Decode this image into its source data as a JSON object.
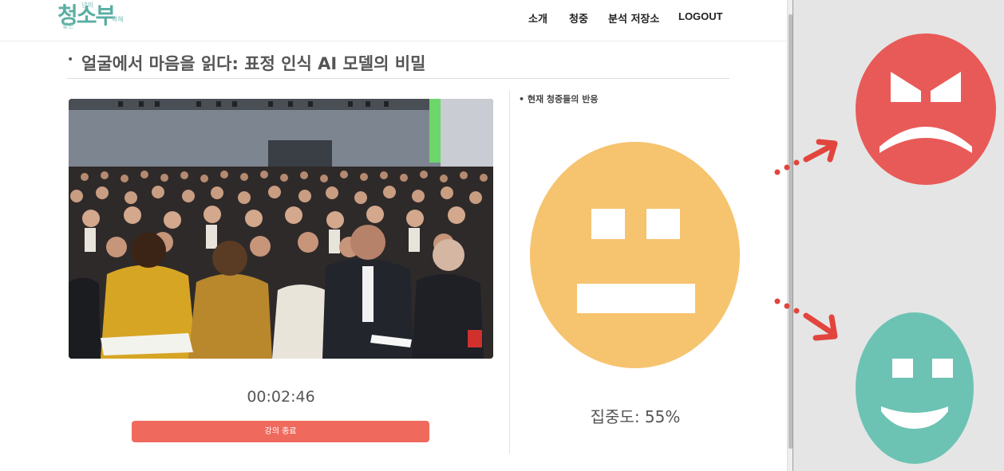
{
  "logo": {
    "main": "청소부",
    "small_top": "년의",
    "small_left": "좋은",
    "small_right": "탁해"
  },
  "nav": {
    "items": [
      "소개",
      "청중",
      "분석 저장소",
      "LOGOUT"
    ]
  },
  "page": {
    "bullet": "•",
    "title": "얼굴에서 마음을 읽다: 표정 인식 AI 모델의 비밀"
  },
  "video": {
    "timer": "00:02:46",
    "end_button": "강의 종료"
  },
  "reaction": {
    "label": "• 현재 청중들의 반응",
    "current_face": "neutral-face-icon",
    "concentration": "집중도: 55%"
  },
  "legend": {
    "faces": [
      "angry-face-icon",
      "happy-face-icon"
    ]
  },
  "colors": {
    "accent_button": "#ef6a5d",
    "neutral_face": "#f6c36e",
    "angry_face": "#e85a58",
    "happy_face": "#6cc3b3",
    "arrow": "#e2453d",
    "logo": "#5aaea3"
  }
}
